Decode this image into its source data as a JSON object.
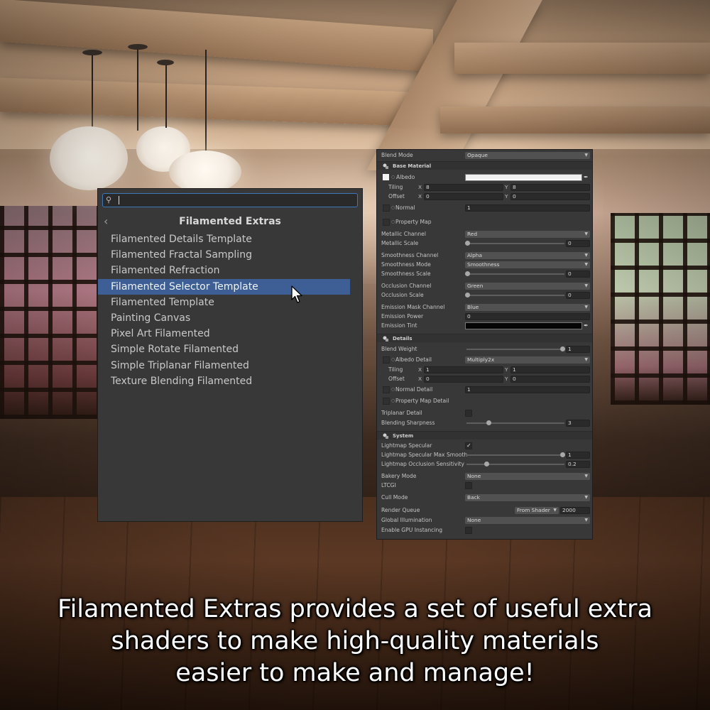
{
  "search": {
    "value": "",
    "placeholder": ""
  },
  "shader_menu": {
    "title": "Filamented Extras",
    "items": [
      "Filamented Details Template",
      "Filamented Fractal Sampling",
      "Filamented Refraction",
      "Filamented Selector Template",
      "Filamented Template",
      "Painting Canvas",
      "Pixel Art Filamented",
      "Simple Rotate Filamented",
      "Simple Triplanar Filamented",
      "Texture Blending Filamented"
    ],
    "selected_index": 3
  },
  "inspector": {
    "blend_mode": {
      "label": "Blend Mode",
      "value": "Opaque"
    },
    "base_material": {
      "header": "Base Material",
      "albedo": "Albedo",
      "tiling": {
        "label": "Tiling",
        "x": "8",
        "y": "8"
      },
      "offset": {
        "label": "Offset",
        "x": "0",
        "y": "0"
      },
      "normal": {
        "label": "Normal",
        "value": "1"
      },
      "property_map": "Property Map",
      "metallic_channel": {
        "label": "Metallic Channel",
        "value": "Red"
      },
      "metallic_scale": {
        "label": "Metallic Scale",
        "value": "0",
        "fraction": 0.0
      },
      "smoothness_channel": {
        "label": "Smoothness Channel",
        "value": "Alpha"
      },
      "smoothness_mode": {
        "label": "Smoothness Mode",
        "value": "Smoothness"
      },
      "smoothness_scale": {
        "label": "Smoothness Scale",
        "value": "0",
        "fraction": 0.0
      },
      "occlusion_channel": {
        "label": "Occlusion Channel",
        "value": "Green"
      },
      "occlusion_scale": {
        "label": "Occlusion Scale",
        "value": "0",
        "fraction": 0.0
      },
      "emission_mask_channel": {
        "label": "Emission Mask Channel",
        "value": "Blue"
      },
      "emission_power": {
        "label": "Emission Power",
        "value": "0"
      },
      "emission_tint": {
        "label": "Emission Tint",
        "color": "#000000"
      },
      "albedo_color": "#ffffff"
    },
    "details": {
      "header": "Details",
      "blend_weight": {
        "label": "Blend Weight",
        "value": "1",
        "fraction": 1.0
      },
      "albedo_detail": {
        "label": "Albedo Detail",
        "value": "Multiply2x"
      },
      "tiling": {
        "label": "Tiling",
        "x": "1",
        "y": "1"
      },
      "offset": {
        "label": "Offset",
        "x": "0",
        "y": "0"
      },
      "normal_detail": {
        "label": "Normal Detail",
        "value": "1"
      },
      "property_map_detail": "Property Map Detail",
      "triplanar_detail": {
        "label": "Triplanar Detail",
        "checked": false
      },
      "blending_sharpness": {
        "label": "Blending Sharpness",
        "value": "3",
        "fraction": 0.2
      }
    },
    "system": {
      "header": "System",
      "lightmap_specular": {
        "label": "Lightmap Specular",
        "checked": true
      },
      "lightmap_specular_max_smooth": {
        "label": "Lightmap Specular Max Smooth",
        "value": "1",
        "fraction": 1.0
      },
      "lightmap_occlusion_sensitivity": {
        "label": "Lightmap Occlusion Sensitivity",
        "value": "0.2",
        "fraction": 0.2
      },
      "bakery_mode": {
        "label": "Bakery Mode",
        "value": "None"
      },
      "ltcgi": {
        "label": "LTCGI",
        "checked": false
      },
      "cull_mode": {
        "label": "Cull Mode",
        "value": "Back"
      },
      "render_queue": {
        "label": "Render Queue",
        "source": "From Shader",
        "value": "2000"
      },
      "global_illumination": {
        "label": "Global Illumination",
        "value": "None"
      },
      "enable_gpu_instancing": {
        "label": "Enable GPU Instancing",
        "checked": false
      }
    }
  },
  "caption": {
    "line1": "Filamented Extras provides a set of useful extra",
    "line2": "shaders to make high-quality materials",
    "line3": "easier to make and manage!"
  }
}
